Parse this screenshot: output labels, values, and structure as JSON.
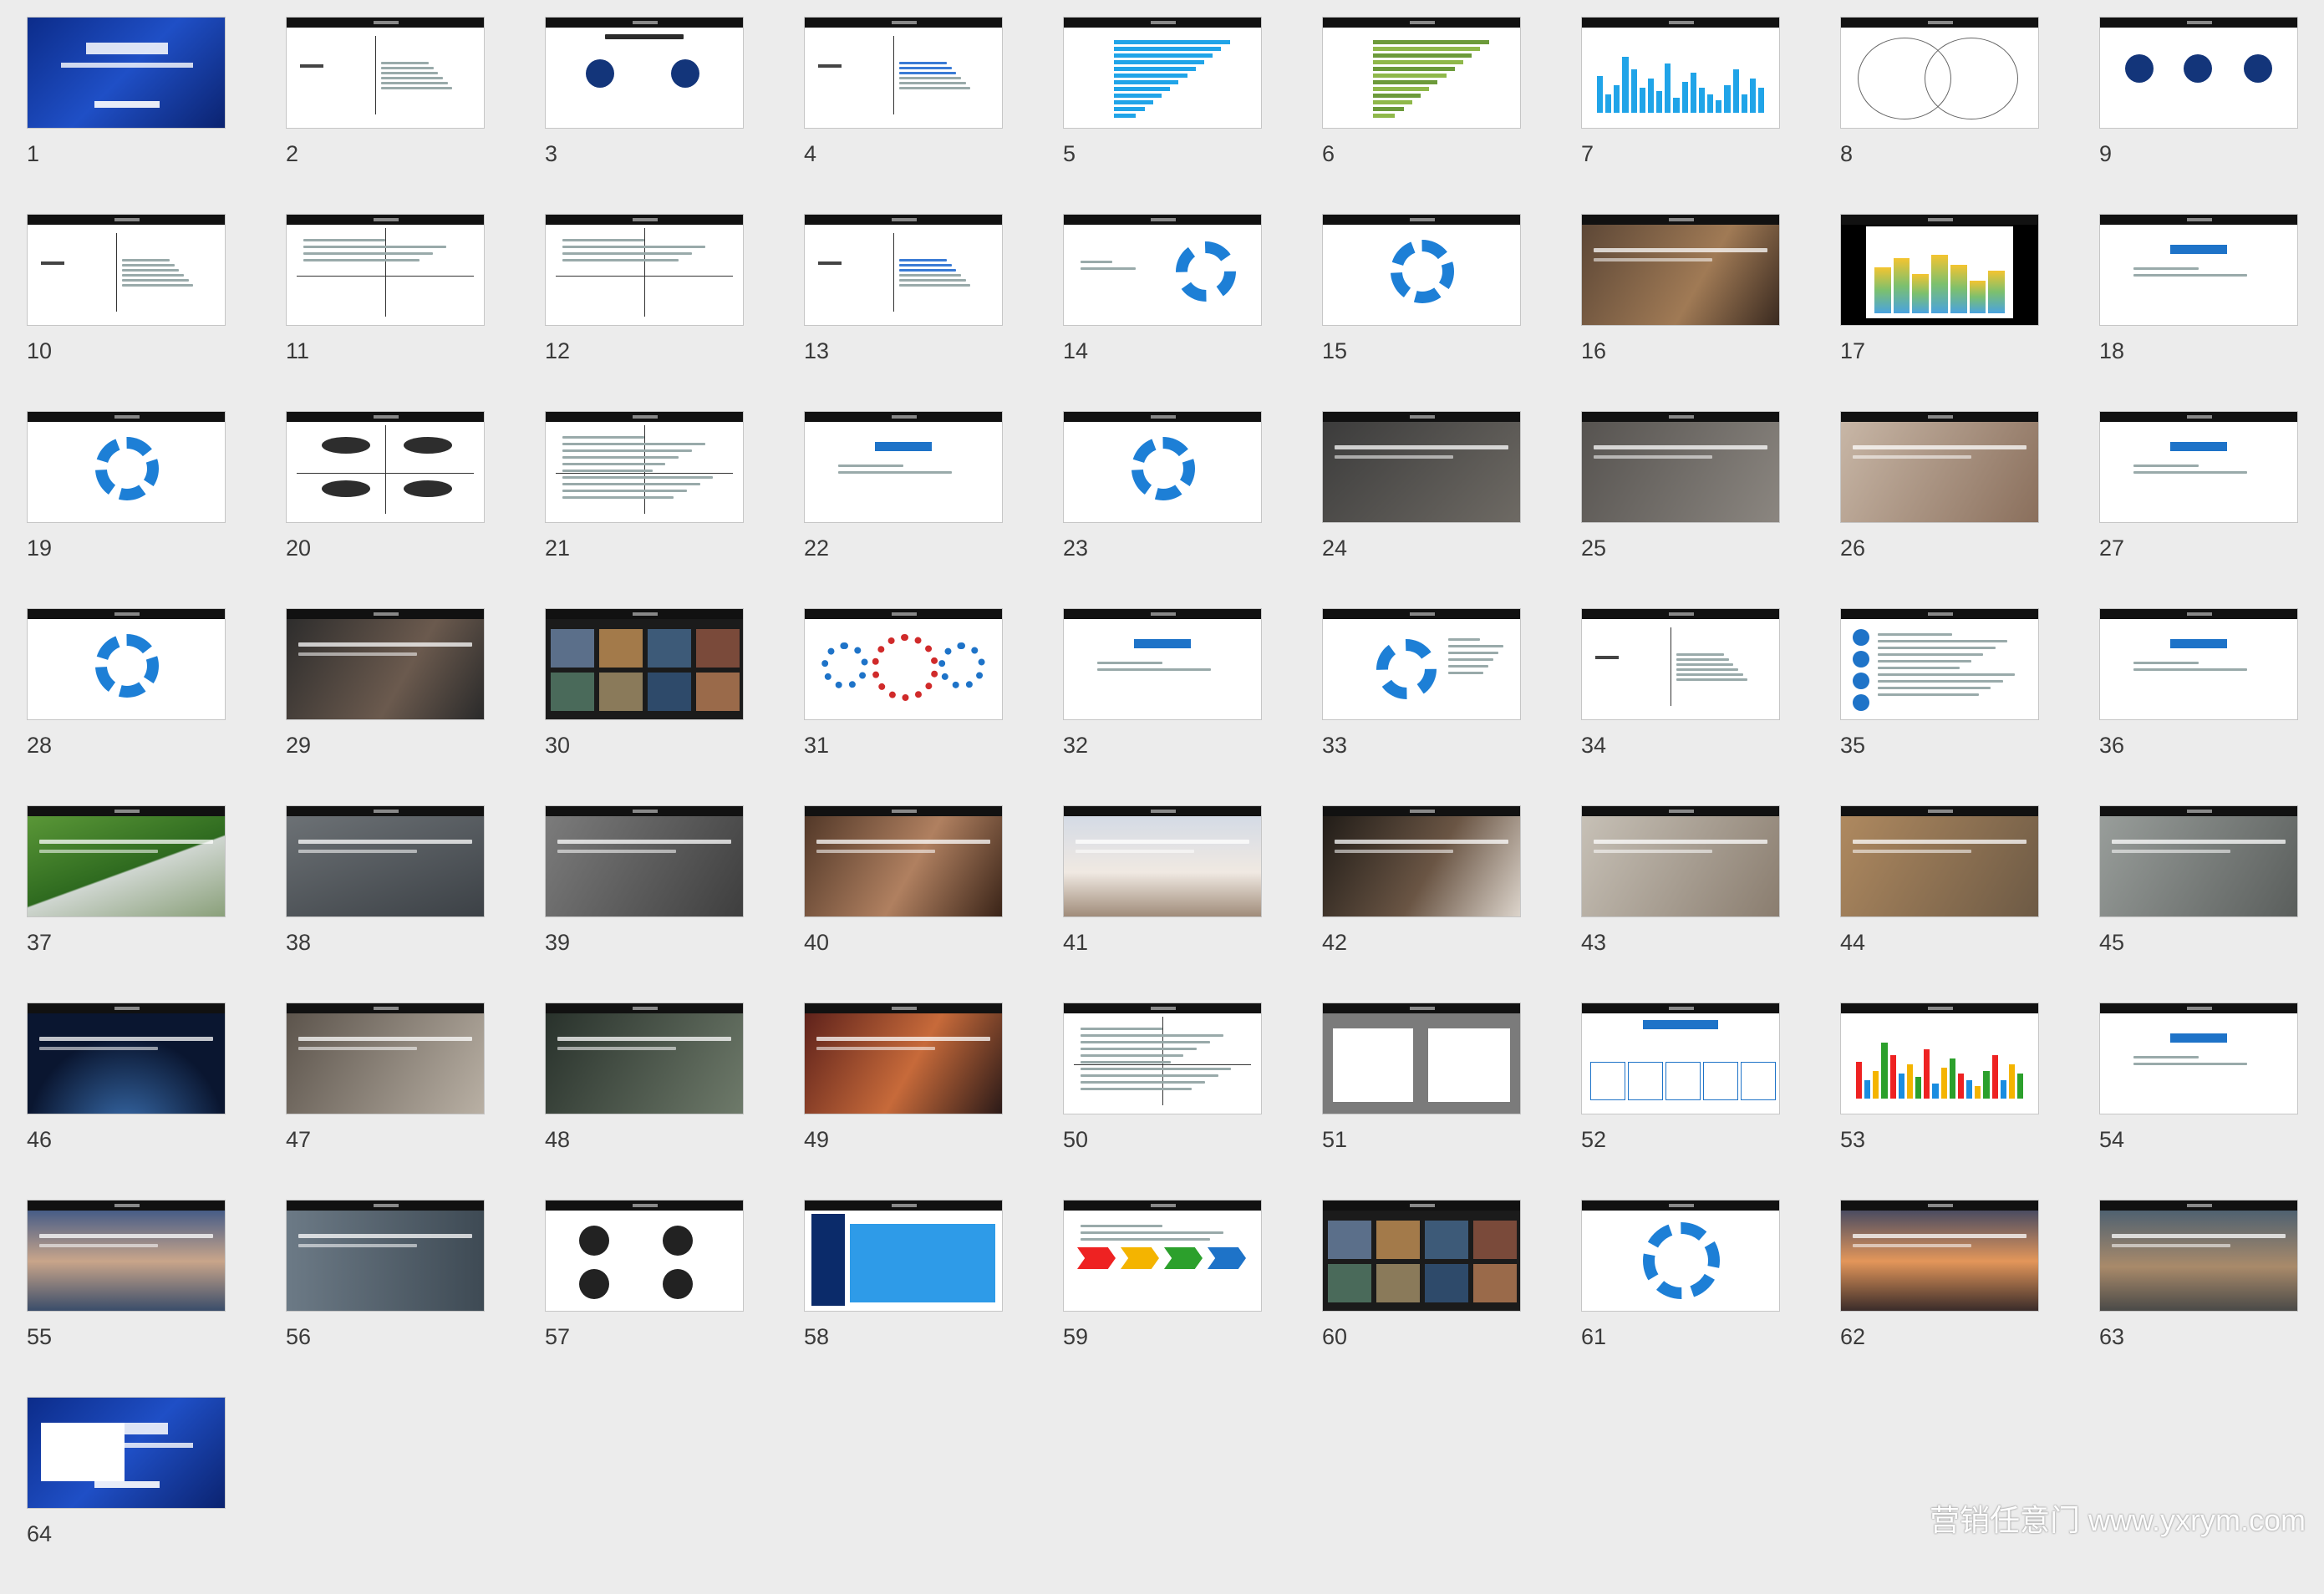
{
  "slides": [
    {
      "n": "1",
      "kind": "cover"
    },
    {
      "n": "2",
      "kind": "agenda"
    },
    {
      "n": "3",
      "kind": "two-circles"
    },
    {
      "n": "4",
      "kind": "agenda-blue"
    },
    {
      "n": "5",
      "kind": "hbar"
    },
    {
      "n": "6",
      "kind": "hbar-green"
    },
    {
      "n": "7",
      "kind": "vbar"
    },
    {
      "n": "8",
      "kind": "venn"
    },
    {
      "n": "9",
      "kind": "three-circles"
    },
    {
      "n": "10",
      "kind": "agenda"
    },
    {
      "n": "11",
      "kind": "quadrant"
    },
    {
      "n": "12",
      "kind": "quadrant"
    },
    {
      "n": "13",
      "kind": "agenda-blue"
    },
    {
      "n": "14",
      "kind": "ring-left"
    },
    {
      "n": "15",
      "kind": "ring"
    },
    {
      "n": "16",
      "kind": "photo-brown"
    },
    {
      "n": "17",
      "kind": "black-chart"
    },
    {
      "n": "18",
      "kind": "blue-button"
    },
    {
      "n": "19",
      "kind": "ring"
    },
    {
      "n": "20",
      "kind": "pills"
    },
    {
      "n": "21",
      "kind": "quadrant-dense"
    },
    {
      "n": "22",
      "kind": "blue-button"
    },
    {
      "n": "23",
      "kind": "ring"
    },
    {
      "n": "24",
      "kind": "photo-dark-charts"
    },
    {
      "n": "25",
      "kind": "photo-pink"
    },
    {
      "n": "26",
      "kind": "photo-child"
    },
    {
      "n": "27",
      "kind": "blue-button"
    },
    {
      "n": "28",
      "kind": "ring"
    },
    {
      "n": "29",
      "kind": "photo-man"
    },
    {
      "n": "30",
      "kind": "collage"
    },
    {
      "n": "31",
      "kind": "gears"
    },
    {
      "n": "32",
      "kind": "blue-button"
    },
    {
      "n": "33",
      "kind": "ring-text"
    },
    {
      "n": "34",
      "kind": "agenda"
    },
    {
      "n": "35",
      "kind": "list-circles"
    },
    {
      "n": "36",
      "kind": "blue-button"
    },
    {
      "n": "37",
      "kind": "photo-train"
    },
    {
      "n": "38",
      "kind": "photo-traffic"
    },
    {
      "n": "39",
      "kind": "photo-phones"
    },
    {
      "n": "40",
      "kind": "photo-cafe"
    },
    {
      "n": "41",
      "kind": "photo-pier"
    },
    {
      "n": "42",
      "kind": "photo-waiter"
    },
    {
      "n": "43",
      "kind": "photo-living"
    },
    {
      "n": "44",
      "kind": "photo-family"
    },
    {
      "n": "45",
      "kind": "photo-kitchen"
    },
    {
      "n": "46",
      "kind": "photo-earth"
    },
    {
      "n": "47",
      "kind": "photo-tea"
    },
    {
      "n": "48",
      "kind": "photo-forest"
    },
    {
      "n": "49",
      "kind": "photo-street"
    },
    {
      "n": "50",
      "kind": "quadrant-dense"
    },
    {
      "n": "51",
      "kind": "grey-panels"
    },
    {
      "n": "52",
      "kind": "blue-table"
    },
    {
      "n": "53",
      "kind": "vbar-red"
    },
    {
      "n": "54",
      "kind": "blue-button"
    },
    {
      "n": "55",
      "kind": "photo-lake"
    },
    {
      "n": "56",
      "kind": "photo-trio"
    },
    {
      "n": "57",
      "kind": "portraits"
    },
    {
      "n": "58",
      "kind": "blue-grid"
    },
    {
      "n": "59",
      "kind": "colored-arrows"
    },
    {
      "n": "60",
      "kind": "collage-city"
    },
    {
      "n": "61",
      "kind": "ring-big"
    },
    {
      "n": "62",
      "kind": "photo-sunset"
    },
    {
      "n": "63",
      "kind": "photo-city"
    },
    {
      "n": "64",
      "kind": "end-cover"
    }
  ],
  "watermark": "营销任意门 www.yxrym.com"
}
